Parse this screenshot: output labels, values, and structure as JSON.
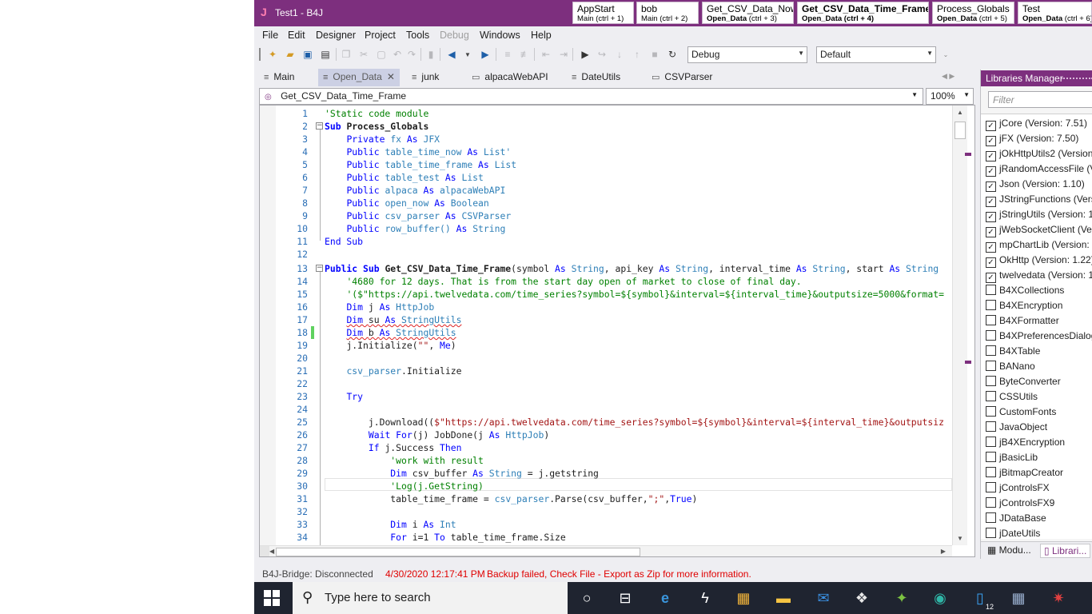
{
  "app": {
    "logo": "J",
    "title": "Test1 - B4J"
  },
  "module_tabs": [
    {
      "name": "AppStart",
      "sub_bold": "",
      "sub": "Main  (ctrl + 1)",
      "bold": false
    },
    {
      "name": "bob",
      "sub_bold": "",
      "sub": "Main  (ctrl + 2)",
      "bold": false
    },
    {
      "name": "Get_CSV_Data_Now",
      "sub_bold": "Open_Data",
      "sub": "  (ctrl + 3)",
      "bold": false
    },
    {
      "name": "Get_CSV_Data_Time_Frame",
      "sub_bold": "Open_Data",
      "sub": "  (ctrl + 4)",
      "bold": true
    },
    {
      "name": "Process_Globals",
      "sub_bold": "Open_Data",
      "sub": "  (ctrl + 5)",
      "bold": false
    },
    {
      "name": "Test",
      "sub_bold": "Open_Data",
      "sub": "  (ctrl + 6)",
      "bold": false
    }
  ],
  "menu": [
    "File",
    "Edit",
    "Designer",
    "Project",
    "Tools",
    "Debug",
    "Windows",
    "Help"
  ],
  "toolbar": {
    "build_config": "Debug",
    "platform": "Default"
  },
  "doc_tabs": [
    {
      "label": "Main",
      "icon": "code-module-icon"
    },
    {
      "label": "Open_Data",
      "icon": "code-module-icon",
      "active": true
    },
    {
      "label": "junk",
      "icon": "code-module-icon"
    },
    {
      "label": "alpacaWebAPI",
      "icon": "class-module-icon"
    },
    {
      "label": "DateUtils",
      "icon": "code-module-icon"
    },
    {
      "label": "CSVParser",
      "icon": "class-module-icon"
    }
  ],
  "sub_selector": {
    "value": "Get_CSV_Data_Time_Frame",
    "zoom": "100%"
  },
  "code_lines": [
    "1",
    "2",
    "3",
    "4",
    "5",
    "6",
    "7",
    "8",
    "9",
    "10",
    "11",
    "12",
    "13",
    "14",
    "15",
    "16",
    "17",
    "18",
    "19",
    "20",
    "21",
    "22",
    "23",
    "24",
    "25",
    "26",
    "27",
    "28",
    "29",
    "30",
    "31",
    "32",
    "33",
    "34"
  ],
  "code": {
    "l1": "'Static code module",
    "l2_kw": "Sub ",
    "l2_name": "Process_Globals",
    "l3_kw": "Private ",
    "l3_a": "fx ",
    "l3_as": "As ",
    "l3_t": "JFX",
    "l4_kw": "Public ",
    "l4_a": "table_time_now ",
    "l4_as": "As ",
    "l4_t": "List'",
    "l5_kw": "Public ",
    "l5_a": "table_time_frame ",
    "l5_as": "As ",
    "l5_t": "List",
    "l6_kw": "Public ",
    "l6_a": "table_test ",
    "l6_as": "As ",
    "l6_t": "List",
    "l7_kw": "Public ",
    "l7_a": "alpaca ",
    "l7_as": "As ",
    "l7_t": "alpacaWebAPI",
    "l8_kw": "Public ",
    "l8_a": "open_now ",
    "l8_as": "As ",
    "l8_t": "Boolean",
    "l9_kw": "Public ",
    "l9_a": "csv_parser ",
    "l9_as": "As ",
    "l9_t": "CSVParser",
    "l10_kw": "Public ",
    "l10_a": "row_buffer() ",
    "l10_as": "As ",
    "l10_t": "String",
    "l11": "End Sub",
    "l13_kw": "Public Sub ",
    "l13_name": "Get_CSV_Data_Time_Frame",
    "l13_p1": "(symbol ",
    "l13_as1": "As ",
    "l13_t1": "String",
    "l13_p2": ", api_key ",
    "l13_as2": "As ",
    "l13_t2": "String",
    "l13_p3": ", interval_time ",
    "l13_as3": "As ",
    "l13_t3": "String",
    "l13_p4": ", start ",
    "l13_as4": "As ",
    "l13_t4": "String",
    "l14": "'4680 for 12 days. That is from the start day open of market to close of final day.",
    "l15": "'($\"https://api.twelvedata.com/time_series?symbol=${symbol}&interval=${interval_time}&outputsize=5000&format=",
    "l16_kw": "Dim ",
    "l16_a": "j ",
    "l16_as": "As ",
    "l16_t": "HttpJob",
    "l17_kw": "Dim ",
    "l17_a": "su ",
    "l17_as": "As ",
    "l17_t": "StringUtils",
    "l18_kw": "Dim ",
    "l18_a": "b ",
    "l18_as": "As ",
    "l18_t": "StringUtils",
    "l19_a": "j.Initialize(",
    "l19_s": "\"\"",
    "l19_b": ", ",
    "l19_me": "Me",
    "l19_c": ")",
    "l21_a": "csv_parser",
    "l21_b": ".Initialize",
    "l23": "Try",
    "l25_a": "j.Download((",
    "l25_s": "$\"https://api.twelvedata.com/time_series?symbol=${symbol}&interval=${interval_time}&outputsiz",
    "l26_kw": "Wait For",
    "l26_a": "(j) JobDone(j ",
    "l26_as": "As ",
    "l26_t": "HttpJob",
    "l26_c": ")",
    "l27_kw": "If ",
    "l27_a": "j.Success ",
    "l27_kw2": "Then",
    "l28": "'work with result",
    "l29_kw": "Dim ",
    "l29_a": "csv_buffer ",
    "l29_as": "As ",
    "l29_t": "String",
    "l29_b": " = j.getstring",
    "l30": "'Log(j.GetString)",
    "l31_a": "table_time_frame = ",
    "l31_b": "csv_parser",
    "l31_c": ".Parse(csv_buffer,",
    "l31_s": "\";\"",
    "l31_d": ",",
    "l31_kw": "True",
    "l31_e": ")",
    "l33_kw": "Dim ",
    "l33_a": "i ",
    "l33_as": "As ",
    "l33_t": "Int",
    "l34_kw": "For ",
    "l34_a": "i=1 ",
    "l34_kw2": "To ",
    "l34_b": "table_time_frame.Size"
  },
  "libraries": {
    "header": "Libraries Manager",
    "filter_placeholder": "Filter",
    "items": [
      {
        "label": "jCore (Version: 7.51)",
        "checked": true
      },
      {
        "label": "jFX (Version: 7.50)",
        "checked": true
      },
      {
        "label": "jOkHttpUtils2 (Version",
        "checked": true
      },
      {
        "label": "jRandomAccessFile (V",
        "checked": true
      },
      {
        "label": "Json (Version: 1.10)",
        "checked": true
      },
      {
        "label": "JStringFunctions (Vers",
        "checked": true
      },
      {
        "label": "jStringUtils (Version: 1",
        "checked": true
      },
      {
        "label": "jWebSocketClient (Ver",
        "checked": true
      },
      {
        "label": "mpChartLib (Version:",
        "checked": true
      },
      {
        "label": "OkHttp (Version: 1.22)",
        "checked": true
      },
      {
        "label": "twelvedata (Version: 1",
        "checked": true
      },
      {
        "label": "B4XCollections",
        "checked": false
      },
      {
        "label": "B4XEncryption",
        "checked": false
      },
      {
        "label": "B4XFormatter",
        "checked": false
      },
      {
        "label": "B4XPreferencesDialog",
        "checked": false
      },
      {
        "label": "B4XTable",
        "checked": false
      },
      {
        "label": "BANano",
        "checked": false
      },
      {
        "label": "ByteConverter",
        "checked": false
      },
      {
        "label": "CSSUtils",
        "checked": false
      },
      {
        "label": "CustomFonts",
        "checked": false
      },
      {
        "label": "JavaObject",
        "checked": false
      },
      {
        "label": "jB4XEncryption",
        "checked": false
      },
      {
        "label": "jBasicLib",
        "checked": false
      },
      {
        "label": "jBitmapCreator",
        "checked": false
      },
      {
        "label": "jControlsFX",
        "checked": false
      },
      {
        "label": "jControlsFX9",
        "checked": false
      },
      {
        "label": "JDataBase",
        "checked": false
      },
      {
        "label": "jDateUtils",
        "checked": false
      }
    ],
    "bottom_tabs": [
      "Modu...",
      "Librari..."
    ]
  },
  "status": {
    "bridge": "B4J-Bridge: Disconnected",
    "time": "4/30/2020 12:17:41 PM",
    "message": "Backup failed, Check File - Export as Zip for more information."
  },
  "taskbar": {
    "search_placeholder": "Type here to search",
    "icons": [
      "cortana-icon",
      "task-view-icon",
      "edge-icon",
      "sparkle-app-icon",
      "store-icon",
      "file-explorer-icon",
      "mail-icon",
      "dropbox-icon",
      "android-icon",
      "edge-dev-icon",
      "phone-icon",
      "calculator-icon",
      "spider-app-icon"
    ],
    "phone_badge": "12"
  }
}
